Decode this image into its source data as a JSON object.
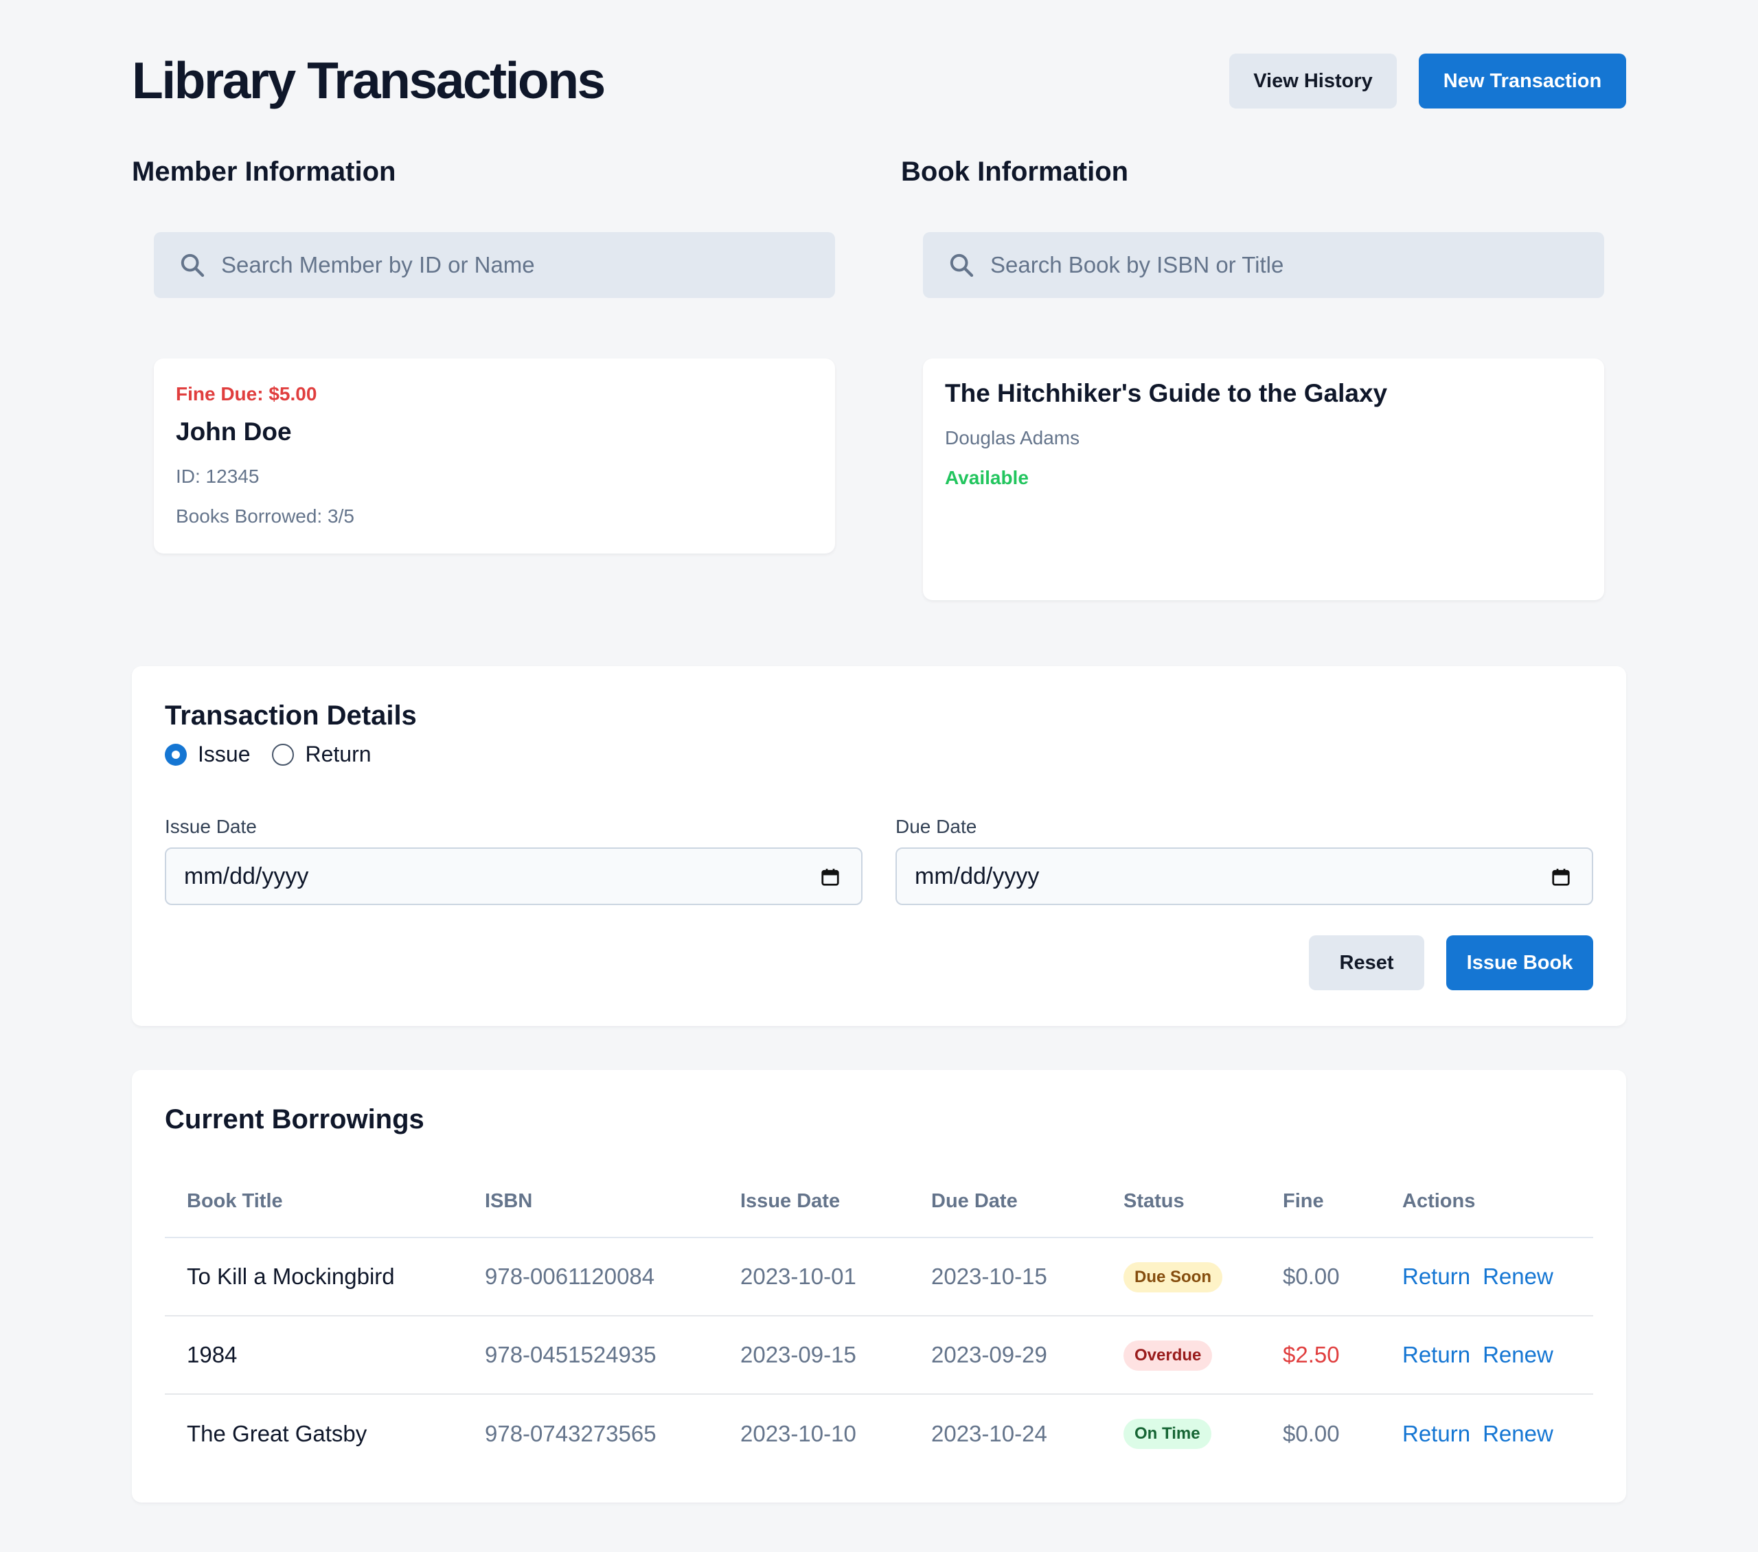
{
  "header": {
    "title": "Library Transactions",
    "view_history": "View History",
    "new_transaction": "New Transaction"
  },
  "member": {
    "section_title": "Member Information",
    "search_placeholder": "Search Member by ID or Name",
    "fine_due": "Fine Due: $5.00",
    "name": "John Doe",
    "id": "ID: 12345",
    "books_borrowed": "Books Borrowed: 3/5"
  },
  "book": {
    "section_title": "Book Information",
    "search_placeholder": "Search Book by ISBN or Title",
    "title": "The Hitchhiker's Guide to the Galaxy",
    "author": "Douglas Adams",
    "status": "Available"
  },
  "transaction": {
    "title": "Transaction Details",
    "radio_issue": "Issue",
    "radio_return": "Return",
    "selected": "Issue",
    "issue_date_label": "Issue Date",
    "issue_date_value": "mm/dd/yyyy",
    "due_date_label": "Due Date",
    "due_date_value": "mm/dd/yyyy",
    "reset": "Reset",
    "issue_book": "Issue Book"
  },
  "borrowings": {
    "title": "Current Borrowings",
    "columns": [
      "Book Title",
      "ISBN",
      "Issue Date",
      "Due Date",
      "Status",
      "Fine",
      "Actions"
    ],
    "rows": [
      {
        "title": "To Kill a Mockingbird",
        "isbn": "978-0061120084",
        "issue": "2023-10-01",
        "due": "2023-10-15",
        "status": "Due Soon",
        "fine": "$0.00",
        "action1": "Return",
        "action2": "Renew"
      },
      {
        "title": "1984",
        "isbn": "978-0451524935",
        "issue": "2023-09-15",
        "due": "2023-09-29",
        "status": "Overdue",
        "fine": "$2.50",
        "action1": "Return",
        "action2": "Renew"
      },
      {
        "title": "The Great Gatsby",
        "isbn": "978-0743273565",
        "issue": "2023-10-10",
        "due": "2023-10-24",
        "status": "On Time",
        "fine": "$0.00",
        "action1": "Return",
        "action2": "Renew"
      }
    ]
  },
  "colors": {
    "primary": "#1576d3",
    "danger": "#e03e3e",
    "success": "#22c55e",
    "background": "#f5f6f8"
  },
  "icons": [
    "search-icon",
    "calendar-icon"
  ]
}
